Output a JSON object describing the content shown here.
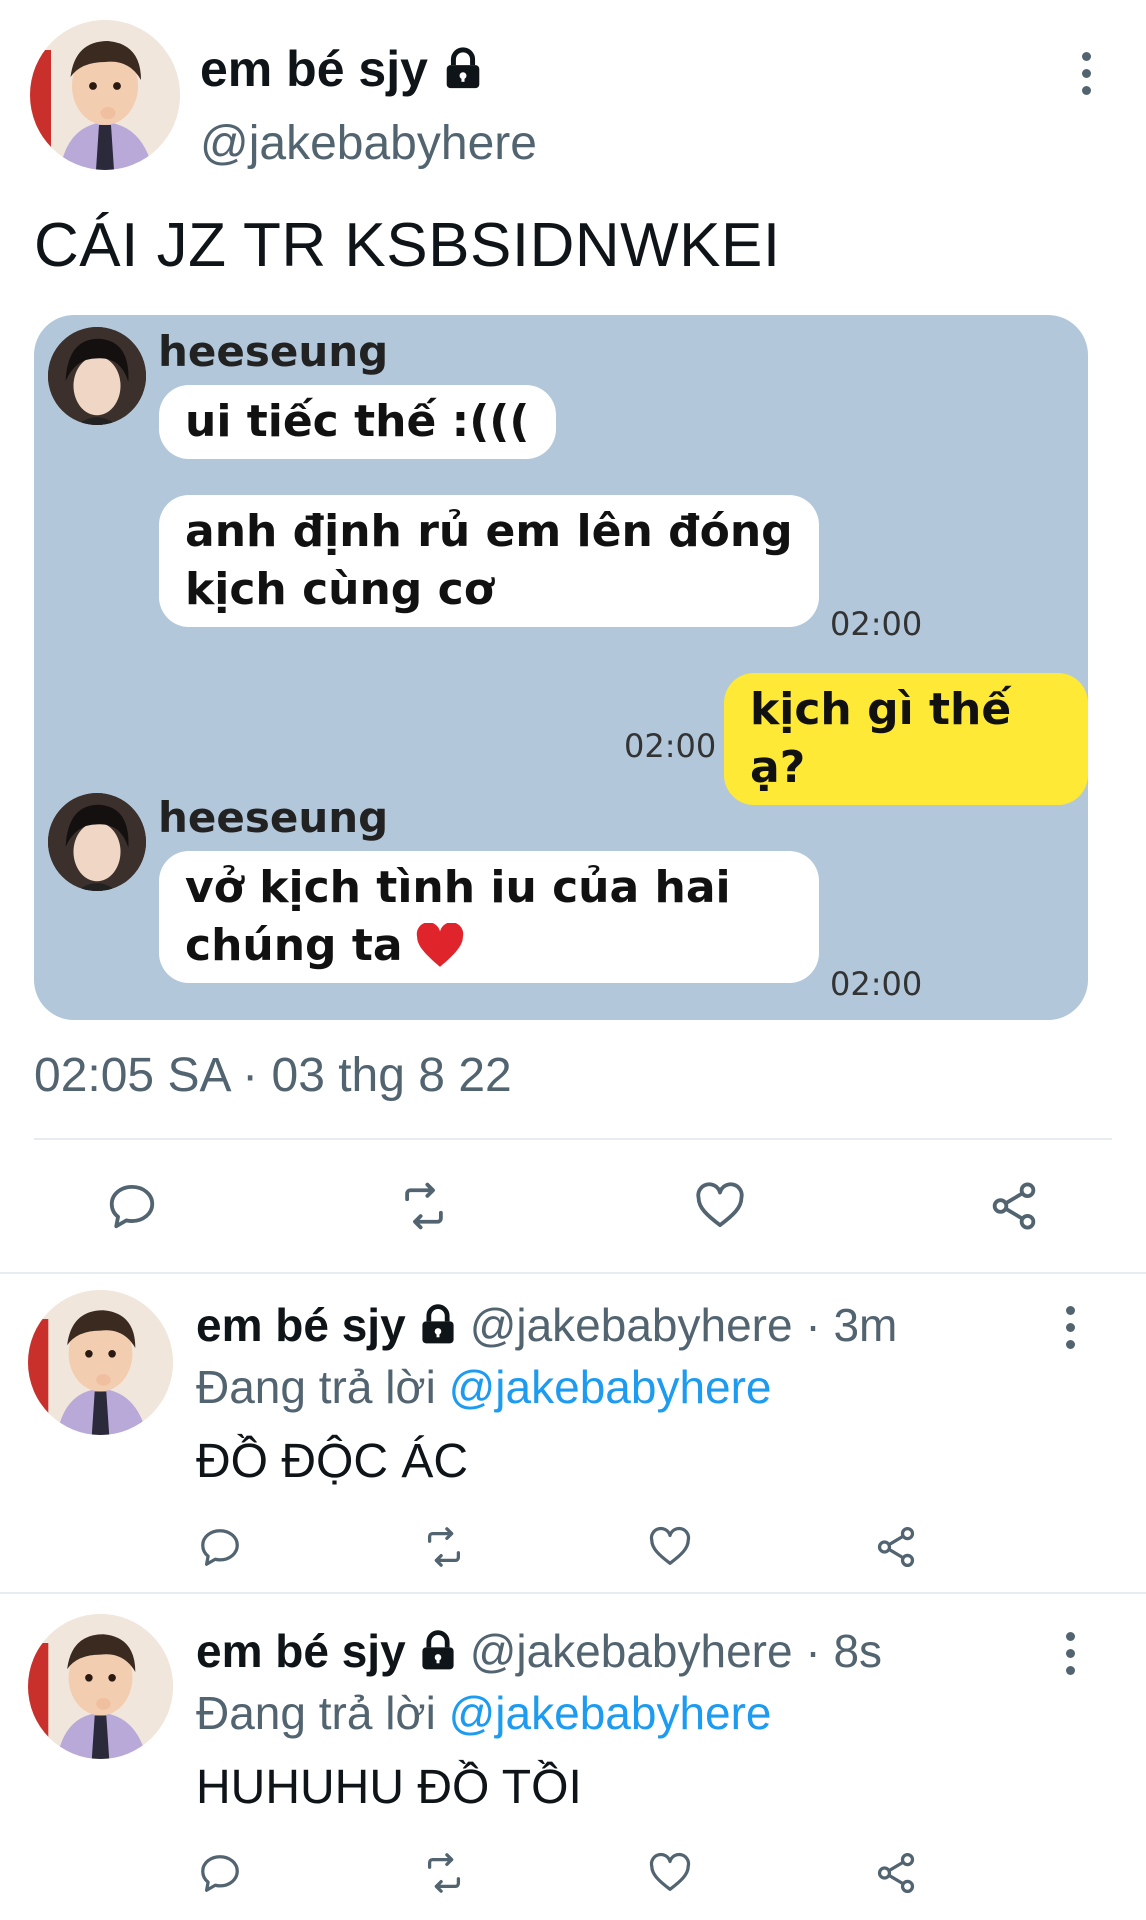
{
  "main_tweet": {
    "display_name": "em bé sjy",
    "handle": "@jakebabyhere",
    "text": "CÁI JZ TR KSBSIDNWKEI",
    "timestamp": "02:05 SA · 03 thg 8 22",
    "protected_icon": "lock-icon",
    "more_icon": "more-vertical-icon"
  },
  "chat_image": {
    "messages": [
      {
        "sender": "heeseung",
        "text_lines": [
          "ui tiếc thế :((("
        ],
        "time": ""
      },
      {
        "sender": "",
        "text_lines": [
          "anh định rủ em lên đóng",
          "kịch cùng cơ"
        ],
        "time": "02:00"
      },
      {
        "sender": "me",
        "text_lines": [
          "kịch gì thế ạ?"
        ],
        "time": "02:00"
      },
      {
        "sender": "heeseung",
        "text_lines": [
          "vở kịch tình iu của hai",
          "chúng ta"
        ],
        "time": "02:00",
        "emoji": "heart"
      }
    ]
  },
  "actions": {
    "icons": [
      "reply-icon",
      "retweet-icon",
      "like-icon",
      "share-icon"
    ]
  },
  "replies": [
    {
      "display_name": "em bé sjy",
      "handle_time": "@jakebabyhere · 3m",
      "replying_prefix": "Đang trả lời ",
      "replying_to": "@jakebabyhere",
      "text": "ĐỒ ĐỘC ÁC"
    },
    {
      "display_name": "em bé sjy",
      "handle_time": "@jakebabyhere · 8s",
      "replying_prefix": "Đang trả lời ",
      "replying_to": "@jakebabyhere",
      "text": "HUHUHU ĐỒ TỒI"
    }
  ],
  "colors": {
    "primary_text": "#0f1419",
    "secondary_text": "#536471",
    "link": "#1d9bf0",
    "chat_background": "#b2c7da",
    "my_bubble": "#fde936"
  }
}
